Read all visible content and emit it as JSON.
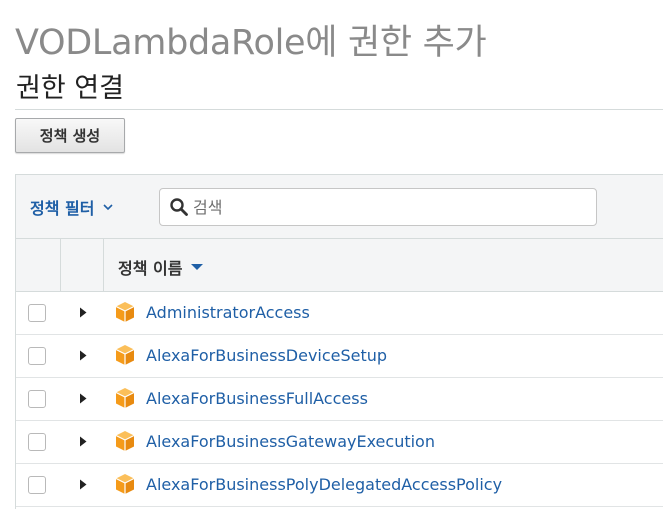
{
  "header": {
    "title": "VODLambdaRole에 권한 추가",
    "section_title": "권한 연결"
  },
  "toolbar": {
    "create_policy_label": "정책 생성"
  },
  "filter": {
    "label": "정책 필터",
    "search_placeholder": "검색"
  },
  "table": {
    "columns": [
      "정책 이름"
    ],
    "sort": "ascending",
    "rows": [
      {
        "name": "AdministratorAccess",
        "checked": false
      },
      {
        "name": "AlexaForBusinessDeviceSetup",
        "checked": false
      },
      {
        "name": "AlexaForBusinessFullAccess",
        "checked": false
      },
      {
        "name": "AlexaForBusinessGatewayExecution",
        "checked": false
      },
      {
        "name": "AlexaForBusinessPolyDelegatedAccessPolicy",
        "checked": false
      }
    ]
  },
  "icons": {
    "filter_dropdown": "chevron-down-icon",
    "search": "search-icon",
    "sort": "sort-desc-icon",
    "row_expand": "caret-right-icon",
    "policy": "policy-cube-icon"
  },
  "colors": {
    "title_gray": "#8a8a8a",
    "link_blue": "#1f5fa6",
    "policy_orange": "#f79f1f",
    "panel_bg": "#f4f5f6"
  }
}
